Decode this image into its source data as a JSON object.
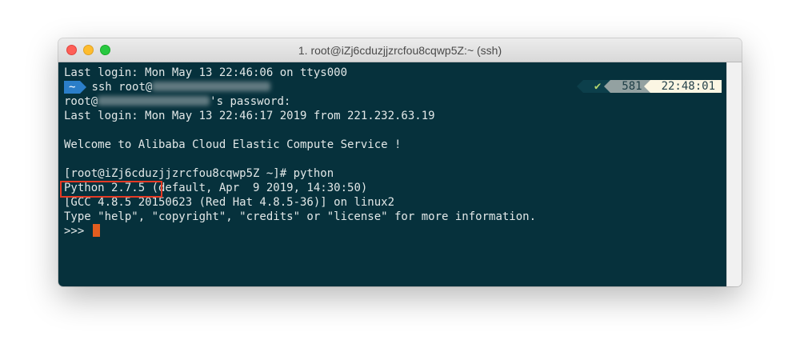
{
  "window": {
    "title": "1. root@iZj6cduzjjzrcfou8cqwp5Z:~ (ssh)"
  },
  "terminal": {
    "line1": "Last login: Mon May 13 22:46:06 on ttys000",
    "prompt_dir": "~",
    "line2_cmd": "ssh root@",
    "right_prompt": {
      "status": "✔",
      "history_number": "581",
      "time": "22:48:01"
    },
    "line3_prefix": "root@",
    "line3_suffix": "'s password:",
    "line4": "Last login: Mon May 13 22:46:17 2019 from 221.232.63.19",
    "line5": "Welcome to Alibaba Cloud Elastic Compute Service !",
    "line6": "[root@iZj6cduzjjzrcfou8cqwp5Z ~]# python",
    "line7_version": "Python 2.7.5 ",
    "line7_rest": "(default, Apr  9 2019, 14:30:50)",
    "line8": "[GCC 4.8.5 20150623 (Red Hat 4.8.5-36)] on linux2",
    "line9": "Type \"help\", \"copyright\", \"credits\" or \"license\" for more information.",
    "line10_prompt": ">>> "
  },
  "colors": {
    "terminal_bg": "#06313c",
    "text": "#e2e8e8",
    "highlight": "#e53a24",
    "cursor": "#e35d1f",
    "prompt_segment": "#2b7ec9"
  }
}
